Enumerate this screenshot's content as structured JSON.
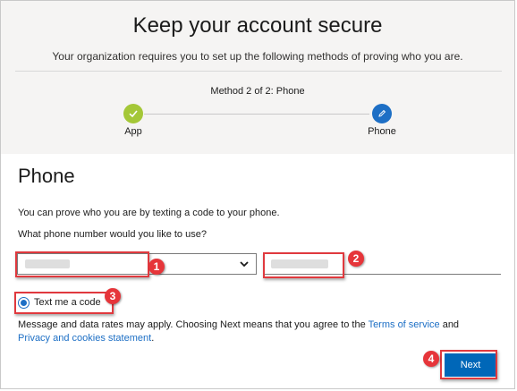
{
  "header": {
    "title": "Keep your account secure",
    "subtitle": "Your organization requires you to set up the following methods of proving who you are.",
    "step_caption": "Method 2 of 2: Phone",
    "steps": [
      {
        "label": "App",
        "status": "done",
        "icon": "checkmark-icon"
      },
      {
        "label": "Phone",
        "status": "current",
        "icon": "pencil-icon"
      }
    ]
  },
  "phone_section": {
    "title": "Phone",
    "description": "You can prove who you are by texting a code to your phone.",
    "question": "What phone number would you like to use?",
    "country_select": {
      "value": ""
    },
    "phone_input": {
      "value": ""
    },
    "radio_option": {
      "label": "Text me a code",
      "checked": true
    },
    "legal_text_before": "Message and data rates may apply. Choosing Next means that you agree to the ",
    "terms_link": "Terms of service",
    "legal_and": " and ",
    "privacy_link": "Privacy and cookies statement",
    "legal_end": ".",
    "next_button": "Next"
  },
  "annotations": {
    "callouts": [
      "1",
      "2",
      "3",
      "4"
    ],
    "highlight_color": "#e0393e"
  },
  "colors": {
    "accent": "#0067b8",
    "done_step": "#a4c737",
    "current_step": "#1d6fc5",
    "link": "#1d6fc5"
  }
}
